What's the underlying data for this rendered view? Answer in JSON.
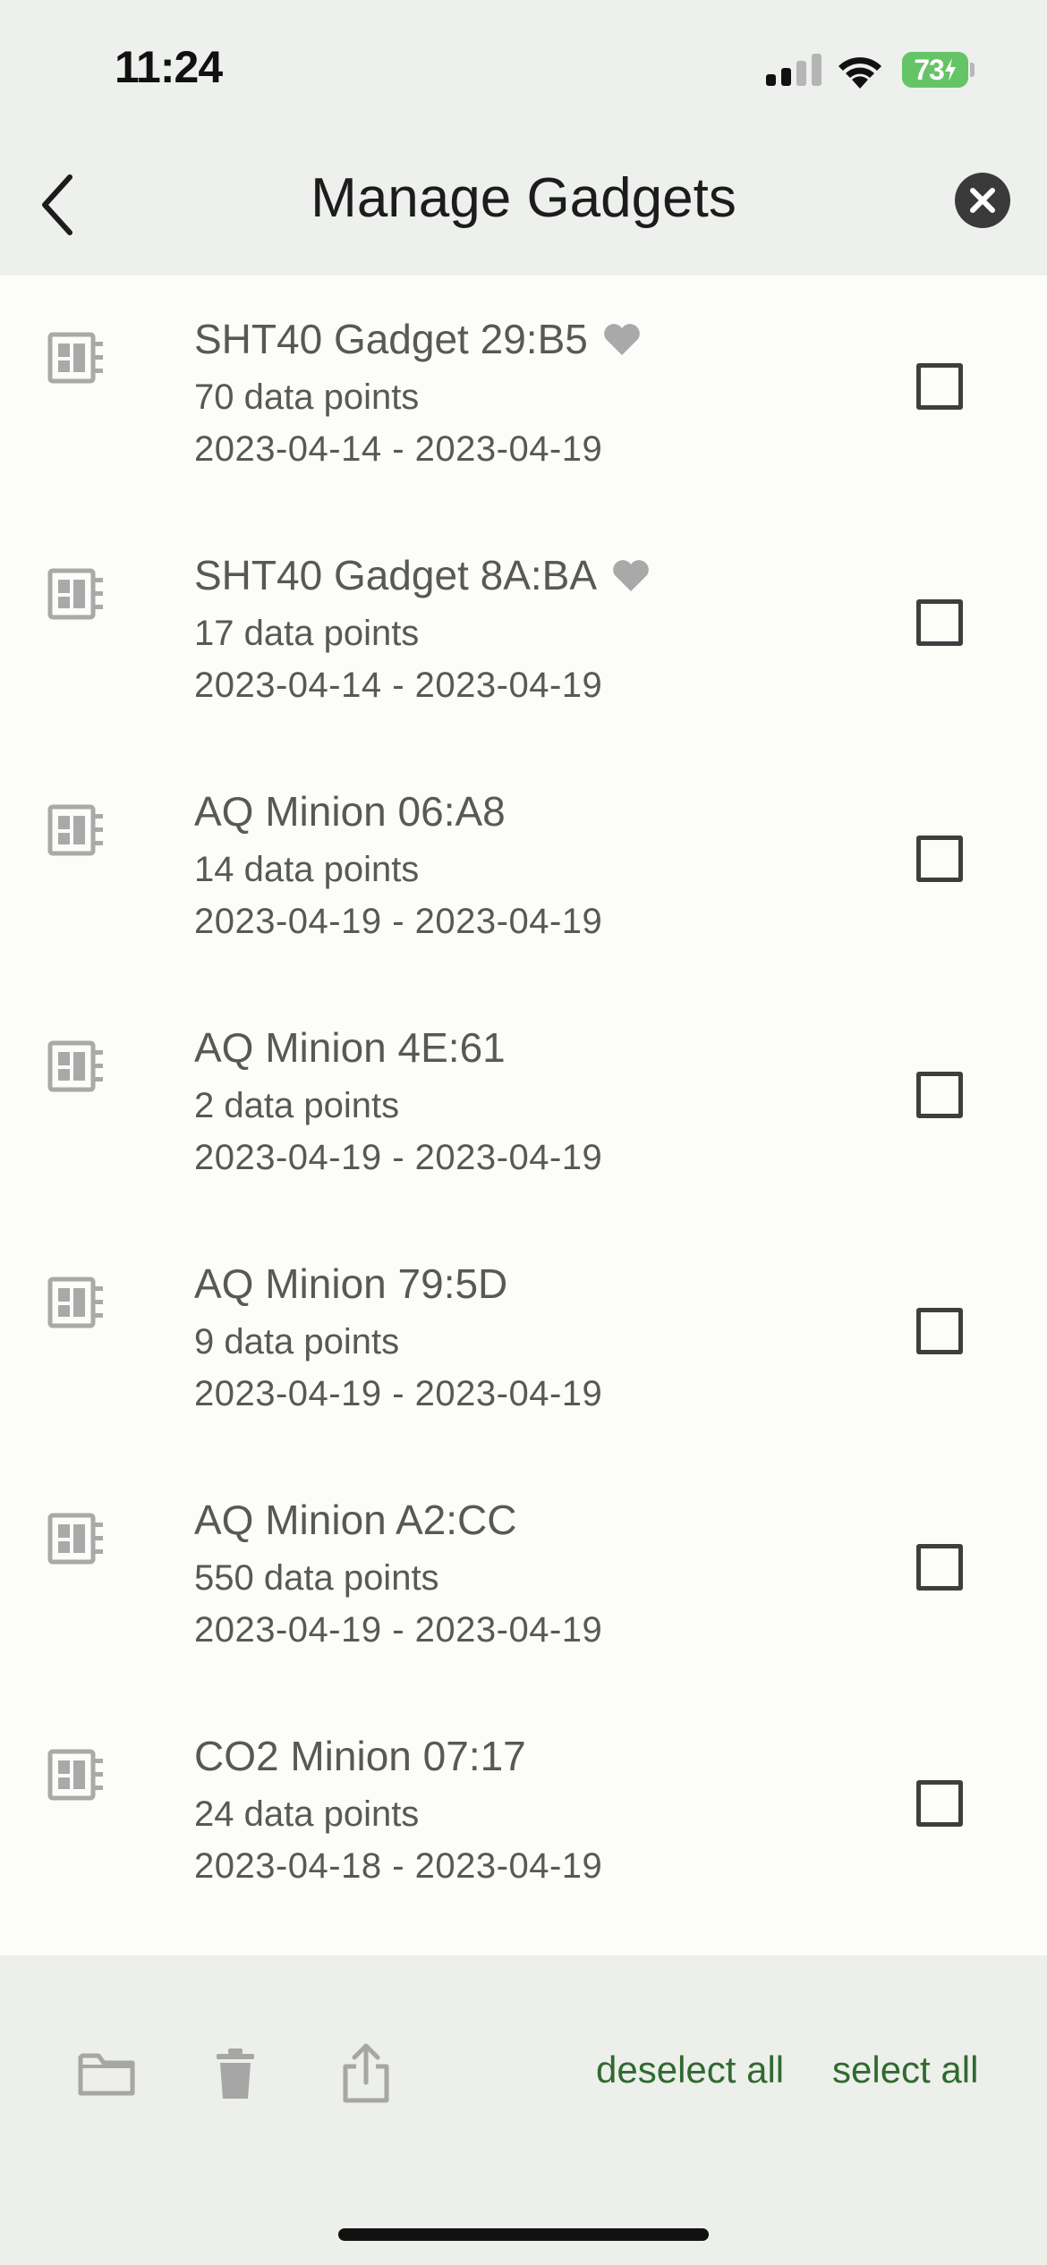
{
  "status_bar": {
    "time": "11:24",
    "battery_percent": "73",
    "battery_color": "#65c466"
  },
  "header": {
    "title": "Manage Gadgets",
    "back_icon": "chevron-left-icon",
    "close_icon": "close-circle-icon"
  },
  "gadgets": [
    {
      "name": "SHT40 Gadget 29:B5",
      "favorite": true,
      "points": "70 data points",
      "dates": "2023-04-14 - 2023-04-19",
      "checked": false
    },
    {
      "name": "SHT40 Gadget 8A:BA",
      "favorite": true,
      "points": "17 data points",
      "dates": "2023-04-14 - 2023-04-19",
      "checked": false
    },
    {
      "name": "AQ Minion 06:A8",
      "favorite": false,
      "points": "14 data points",
      "dates": "2023-04-19 - 2023-04-19",
      "checked": false
    },
    {
      "name": "AQ Minion 4E:61",
      "favorite": false,
      "points": "2 data points",
      "dates": "2023-04-19 - 2023-04-19",
      "checked": false
    },
    {
      "name": "AQ Minion 79:5D",
      "favorite": false,
      "points": "9 data points",
      "dates": "2023-04-19 - 2023-04-19",
      "checked": false
    },
    {
      "name": "AQ Minion A2:CC",
      "favorite": false,
      "points": "550 data points",
      "dates": "2023-04-19 - 2023-04-19",
      "checked": false
    },
    {
      "name": "CO2 Minion 07:17",
      "favorite": false,
      "points": "24 data points",
      "dates": "2023-04-18 - 2023-04-19",
      "checked": false
    }
  ],
  "toolbar": {
    "folder_icon": "folder-icon",
    "delete_icon": "trash-icon",
    "share_icon": "share-icon",
    "deselect_all": "deselect all",
    "select_all": "select all",
    "accent_color": "#2f6a2f"
  }
}
